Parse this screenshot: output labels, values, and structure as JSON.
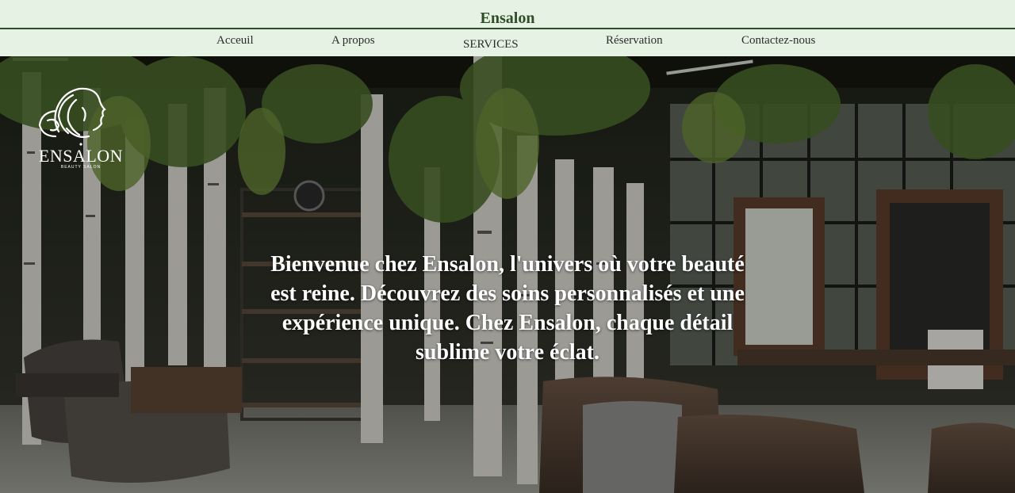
{
  "header": {
    "site_title": "Ensalon",
    "nav": {
      "accueil": "Acceuil",
      "a_propos": "A propos",
      "services": "SERVICES",
      "reservation": "Réservation",
      "contact": "Contactez-nous"
    }
  },
  "hero": {
    "logo_name": "ENSALON",
    "logo_tagline": "BEAUTY SALON",
    "message": "Bienvenue chez Ensalon, l'univers où votre beauté est reine. Découvrez des soins personnalisés et une expérience unique. Chez Ensalon, chaque détail sublime votre éclat."
  },
  "colors": {
    "header_background": "#e6f2e4",
    "title_color": "#2f4d26",
    "nav_text": "#2c2c2c",
    "hero_text": "#ffffff"
  }
}
